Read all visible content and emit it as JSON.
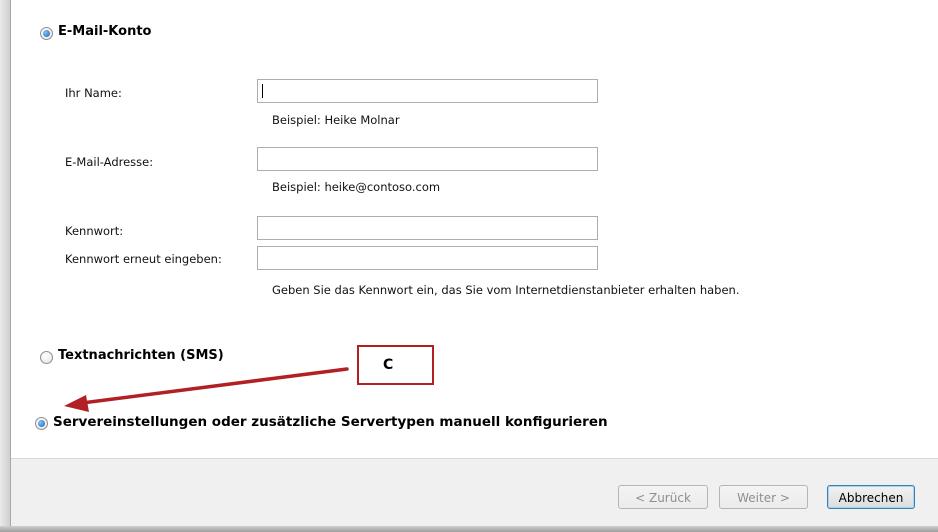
{
  "options": {
    "email_account": {
      "label": "E-Mail-Konto",
      "selected": true
    },
    "sms": {
      "label": "Textnachrichten (SMS)",
      "selected": false
    },
    "manual": {
      "label": "Servereinstellungen oder zusätzliche Servertypen manuell konfigurieren",
      "selected": true
    }
  },
  "form": {
    "name": {
      "label": "Ihr Name:",
      "value": "",
      "hint": "Beispiel: Heike Molnar"
    },
    "email": {
      "label": "E-Mail-Adresse:",
      "value": "",
      "hint": "Beispiel: heike@contoso.com"
    },
    "password": {
      "label": "Kennwort:",
      "value": ""
    },
    "password_confirm": {
      "label": "Kennwort erneut eingeben:",
      "value": ""
    },
    "password_hint": "Geben Sie das Kennwort ein, das Sie vom Internetdienstanbieter erhalten haben."
  },
  "annotation": {
    "label": "C",
    "color": "#b22024"
  },
  "buttons": {
    "back": "< Zurück",
    "next": "Weiter >",
    "cancel": "Abbrechen"
  }
}
